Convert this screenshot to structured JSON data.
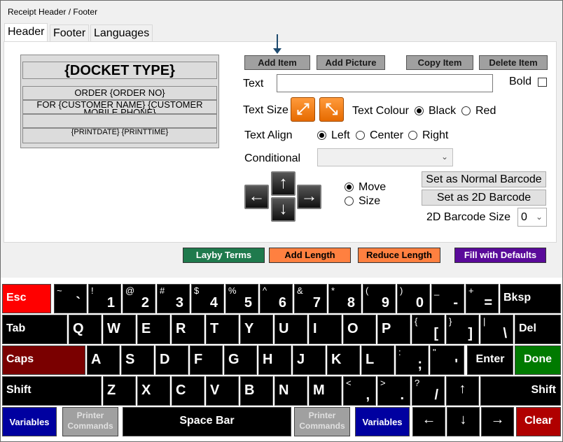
{
  "window": {
    "title": "Receipt Header / Footer"
  },
  "tabs": [
    {
      "label": "Header"
    },
    {
      "label": "Footer"
    },
    {
      "label": "Languages"
    }
  ],
  "preview": {
    "docket": "{DOCKET TYPE}",
    "order": "ORDER {ORDER NO}",
    "customer": "FOR {CUSTOMER NAME} {CUSTOMER",
    "customer2": "MOBILE PHONE}",
    "print": "{PRINTDATE} {PRINTTIME}"
  },
  "toolbar": {
    "add_item": "Add Item",
    "add_picture": "Add Picture",
    "copy_item": "Copy Item",
    "delete_item": "Delete Item"
  },
  "form": {
    "text_label": "Text",
    "text_value": "",
    "bold_label": "Bold",
    "text_size_label": "Text Size",
    "text_colour_label": "Text Colour",
    "black": "Black",
    "red": "Red",
    "text_align_label": "Text Align",
    "left": "Left",
    "center": "Center",
    "right": "Right",
    "conditional_label": "Conditional",
    "conditional_value": "",
    "move": "Move",
    "size": "Size",
    "normal_barcode": "Set as Normal Barcode",
    "barcode_2d": "Set as 2D Barcode",
    "barcode_size_label": "2D Barcode Size",
    "barcode_size_value": "0"
  },
  "commands": {
    "layby": "Layby Terms",
    "add_length": "Add Length",
    "reduce_length": "Reduce Length",
    "fill_defaults": "Fill with Defaults"
  },
  "colors": {
    "layby": "#1f7a4d",
    "add_length": "#ff8040",
    "reduce_length": "#ff8040",
    "fill_defaults": "#5a0a9a",
    "esc": "#ff0000",
    "caps": "#7a0000",
    "done": "#007a00",
    "clear": "#b00000"
  },
  "keyboard": {
    "row1": [
      {
        "main": "Esc"
      },
      {
        "sub": "~",
        "main": "`"
      },
      {
        "sub": "!",
        "main": "1"
      },
      {
        "sub": "@",
        "main": "2"
      },
      {
        "sub": "#",
        "main": "3"
      },
      {
        "sub": "$",
        "main": "4"
      },
      {
        "sub": "%",
        "main": "5"
      },
      {
        "sub": "^",
        "main": "6"
      },
      {
        "sub": "&",
        "main": "7"
      },
      {
        "sub": "*",
        "main": "8"
      },
      {
        "sub": "(",
        "main": "9"
      },
      {
        "sub": ")",
        "main": "0"
      },
      {
        "sub": "_",
        "main": "-"
      },
      {
        "sub": "+",
        "main": "="
      },
      {
        "main": "Bksp"
      }
    ],
    "row2": [
      {
        "main": "Tab"
      },
      {
        "main": "Q"
      },
      {
        "main": "W"
      },
      {
        "main": "E"
      },
      {
        "main": "R"
      },
      {
        "main": "T"
      },
      {
        "main": "Y"
      },
      {
        "main": "U"
      },
      {
        "main": "I"
      },
      {
        "main": "O"
      },
      {
        "main": "P"
      },
      {
        "sub": "{",
        "main": "["
      },
      {
        "sub": "}",
        "main": "]"
      },
      {
        "sub": "|",
        "main": "\\"
      },
      {
        "main": "Del"
      }
    ],
    "row3": [
      {
        "main": "Caps"
      },
      {
        "main": "A"
      },
      {
        "main": "S"
      },
      {
        "main": "D"
      },
      {
        "main": "F"
      },
      {
        "main": "G"
      },
      {
        "main": "H"
      },
      {
        "main": "J"
      },
      {
        "main": "K"
      },
      {
        "main": "L"
      },
      {
        "sub": ":",
        "main": ";"
      },
      {
        "sub": "\"",
        "main": "'"
      },
      {
        "main": "Enter"
      },
      {
        "main": "Done"
      }
    ],
    "row4": [
      {
        "main": "Shift"
      },
      {
        "main": "Z"
      },
      {
        "main": "X"
      },
      {
        "main": "C"
      },
      {
        "main": "V"
      },
      {
        "main": "B"
      },
      {
        "main": "N"
      },
      {
        "main": "M"
      },
      {
        "sub": "<",
        "main": ","
      },
      {
        "sub": ">",
        "main": "."
      },
      {
        "sub": "?",
        "main": "/"
      },
      {
        "main": "↑"
      },
      {
        "main": "Shift"
      }
    ],
    "row5": [
      {
        "main": "Variables"
      },
      {
        "main": "Printer Commands"
      },
      {
        "main": "Space Bar"
      },
      {
        "main": "Printer Commands"
      },
      {
        "main": "Variables"
      },
      {
        "main": "←"
      },
      {
        "main": "↓"
      },
      {
        "main": "→"
      },
      {
        "main": "Clear"
      }
    ]
  }
}
